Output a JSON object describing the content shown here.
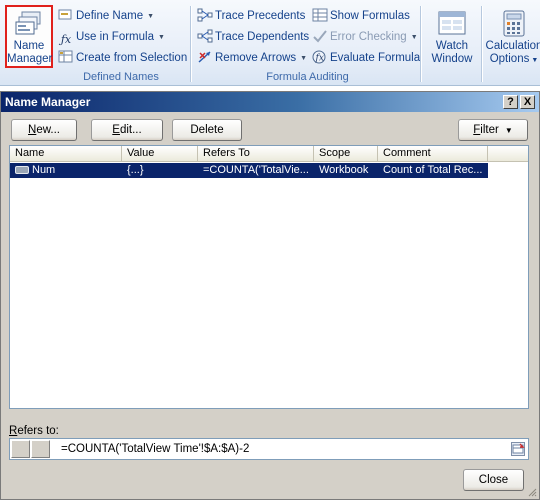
{
  "ribbon": {
    "name_manager": {
      "line1": "Name",
      "line2": "Manager"
    },
    "defined_names": {
      "define_name": "Define Name",
      "use_in_formula": "Use in Formula",
      "create_from_selection": "Create from Selection",
      "group_label": "Defined Names"
    },
    "formula_auditing": {
      "trace_precedents": "Trace Precedents",
      "trace_dependents": "Trace Dependents",
      "remove_arrows": "Remove Arrows",
      "show_formulas": "Show Formulas",
      "error_checking": "Error Checking",
      "evaluate_formula": "Evaluate Formula",
      "group_label": "Formula Auditing"
    },
    "watch_window": {
      "line1": "Watch",
      "line2": "Window"
    },
    "calculation_options": {
      "line1": "Calculation",
      "line2": "Options"
    }
  },
  "dialog": {
    "title": "Name Manager",
    "help_label": "?",
    "close_label": "X",
    "buttons": {
      "new_accel": "N",
      "new_rest": "ew...",
      "edit_accel": "E",
      "edit_rest": "dit...",
      "delete": "Delete",
      "filter_accel": "F",
      "filter_rest": "ilter"
    },
    "columns": [
      "Name",
      "Value",
      "Refers To",
      "Scope",
      "Comment"
    ],
    "rows": [
      {
        "name": "Num",
        "value": "{...}",
        "refers_to": "=COUNTA('TotalVie...",
        "scope": "Workbook",
        "comment": "Count of Total Rec..."
      }
    ],
    "refers_to_label_accel": "R",
    "refers_to_label_rest": "efers to:",
    "refers_to_value": "=COUNTA('TotalView Time'!$A:$A)-2",
    "close_button": "Close"
  },
  "colors": {
    "highlight": "#0a246a",
    "name_manager_outline": "#e0211c",
    "title_bar": "#0a246a"
  }
}
